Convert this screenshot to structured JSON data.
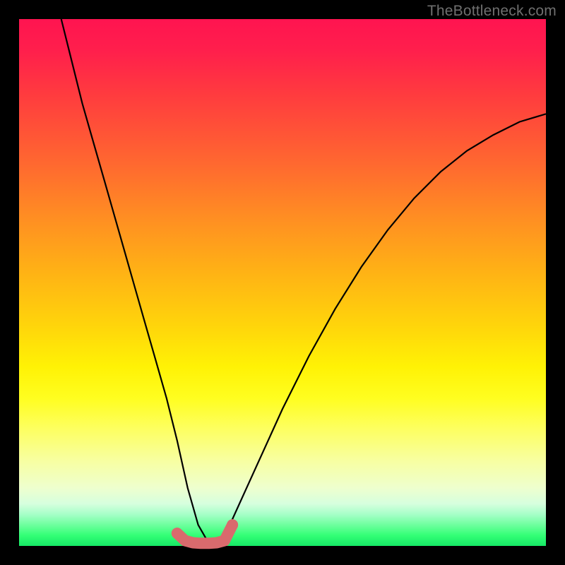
{
  "watermark": "TheBottleneck.com",
  "colors": {
    "curve": "#000000",
    "marker": "#d96a6d",
    "background_black": "#000000"
  },
  "chart_data": {
    "type": "line",
    "title": "",
    "xlabel": "",
    "ylabel": "",
    "xlim": [
      0,
      100
    ],
    "ylim": [
      0,
      100
    ],
    "grid": false,
    "legend": false,
    "annotations": [],
    "series": [
      {
        "name": "bottleneck-curve",
        "color": "#000000",
        "x": [
          8,
          10,
          12,
          14,
          16,
          18,
          20,
          22,
          24,
          26,
          28,
          30,
          32,
          34,
          36,
          38,
          40,
          45,
          50,
          55,
          60,
          65,
          70,
          75,
          80,
          85,
          90,
          95,
          100
        ],
        "y": [
          100,
          92,
          84,
          77,
          70,
          63,
          56,
          49,
          42,
          35,
          28,
          20,
          11,
          4,
          0.5,
          0.5,
          4,
          15,
          26,
          36,
          45,
          53,
          60,
          66,
          71,
          75,
          78,
          80.5,
          82
        ]
      },
      {
        "name": "optimal-range-markers",
        "type": "scatter",
        "color": "#d96a6d",
        "x": [
          30.0,
          31.5,
          33.0,
          34.5,
          36.0,
          37.5,
          39.0,
          40.5
        ],
        "y": [
          2.4,
          1.0,
          0.6,
          0.5,
          0.5,
          0.6,
          1.0,
          4.0
        ]
      }
    ]
  }
}
